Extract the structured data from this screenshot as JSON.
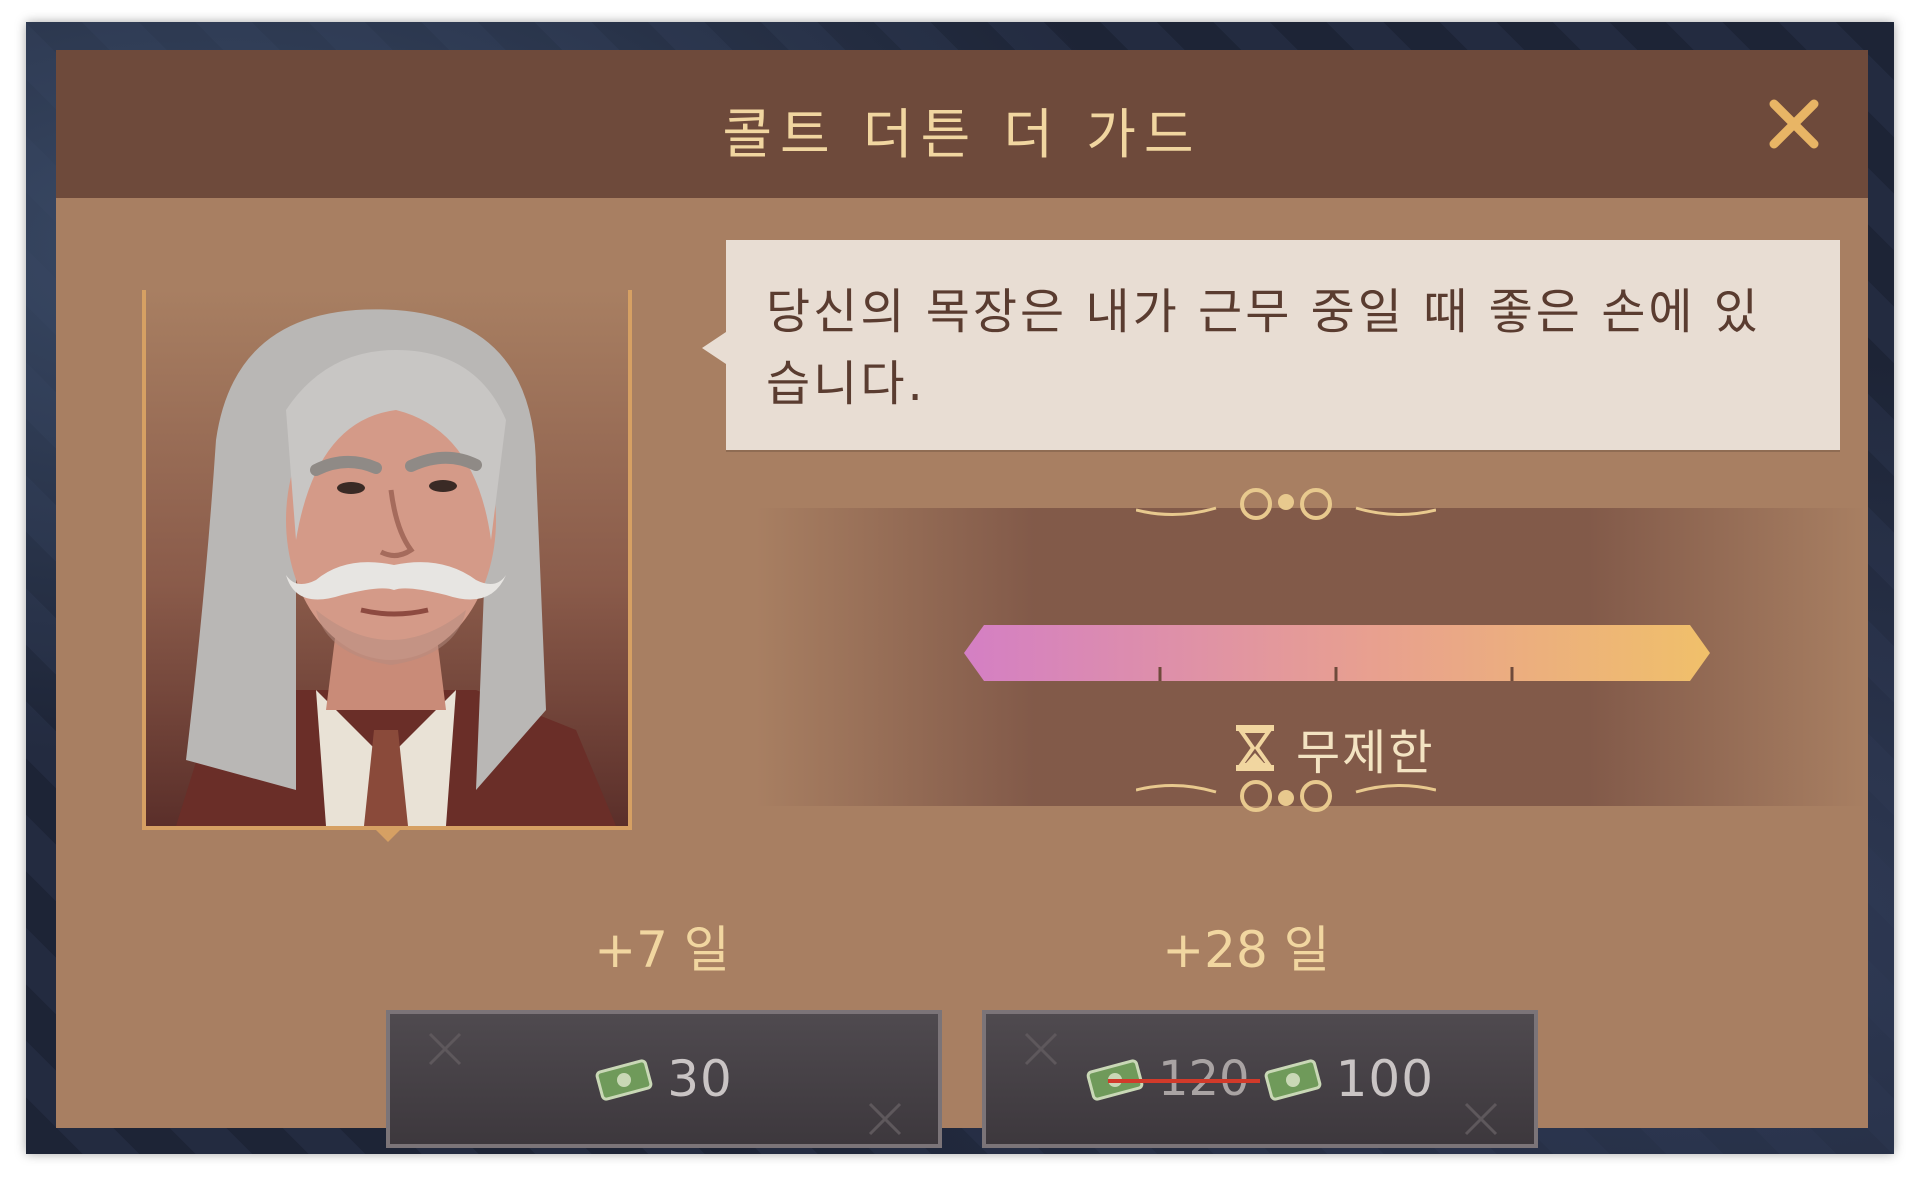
{
  "dialog": {
    "title": "콜트 더튼 더 가드",
    "close_icon": "close-icon"
  },
  "character": {
    "portrait": "gray-haired-mustached-guard-portrait",
    "speech": "당신의 목장은 내가 근무 중일 때 좋은 손에 있습니다."
  },
  "status": {
    "timer_icon": "hourglass-icon",
    "duration_label": "무제한",
    "progress_colors": [
      "#d47fc4",
      "#e8a08f",
      "#f0c06a"
    ]
  },
  "offers": [
    {
      "duration": "+7 일",
      "currency_icon": "money-icon",
      "price": "30"
    },
    {
      "duration": "+28 일",
      "currency_icon": "money-icon",
      "old_price": "120",
      "price": "100"
    }
  ],
  "colors": {
    "header": "#6e4a3b",
    "panel": "#a87f62",
    "title_gold": "#f1d6a0",
    "button": "#4a454a"
  }
}
